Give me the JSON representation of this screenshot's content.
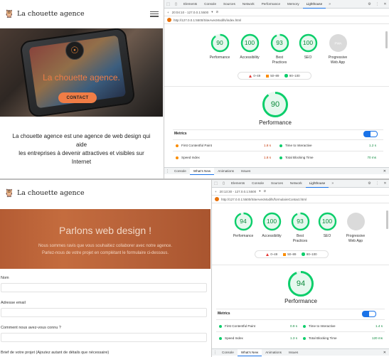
{
  "top_site": {
    "brand": "La chouette agence",
    "hero_title": "La chouette agence.",
    "contact_label": "CONTACT",
    "intro_line1": "La chouette agence est une agence de web design qui",
    "intro_line2": "aide",
    "intro_line3": "les entreprises à devenir attractives et visibles sur",
    "intro_line4": "Internet"
  },
  "bottom_site": {
    "brand": "La chouette agence",
    "banner_title": "Parlons web design !",
    "banner_p1": "Nous sommes ravis que vous souhaitiez collaborer avec notre agence.",
    "banner_p2": "Parlez-nous de votre projet en complétant le formulaire ci-dessous.",
    "fields": [
      {
        "label": "Nom"
      },
      {
        "label": "Adresse email"
      },
      {
        "label": "Comment nous avez-vous connu ?"
      },
      {
        "label": "Brief de votre projet (Ajoutez autant de détails que nécessaire)"
      }
    ]
  },
  "devtools_top": {
    "tabs": [
      "Elements",
      "Console",
      "Sources",
      "Network",
      "Performance",
      "Memory",
      "Lighthouse"
    ],
    "active_tab": "Lighthouse",
    "report_label": "20:04:10 - 127.0.0.1:5500",
    "url": "http://127.0.0.1:5500/SiteAvecModifs/index.html",
    "gauges": [
      {
        "score": "90",
        "label1": "Performance",
        "label2": "",
        "color": "#0cce6b"
      },
      {
        "score": "100",
        "label1": "Accessibility",
        "label2": "",
        "color": "#0cce6b"
      },
      {
        "score": "93",
        "label1": "Best",
        "label2": "Practices",
        "color": "#0cce6b"
      },
      {
        "score": "100",
        "label1": "SEO",
        "label2": "",
        "color": "#0cce6b"
      },
      {
        "score": "PWA",
        "label1": "Progressive",
        "label2": "Web App",
        "color": "#cccccc"
      }
    ],
    "legend": [
      "0–49",
      "50–89",
      "90–100"
    ],
    "perf_score": "90",
    "perf_title": "Performance",
    "metrics_heading": "Metrics",
    "metrics": [
      {
        "name": "First Contentful Paint",
        "value": "1.8 s",
        "status": "orange"
      },
      {
        "name": "Time to Interactive",
        "value": "1.2 s",
        "status": "green"
      },
      {
        "name": "Speed Index",
        "value": "1.8 s",
        "status": "orange"
      },
      {
        "name": "Total Blocking Time",
        "value": "70 ms",
        "status": "green"
      }
    ],
    "drawer_tabs": [
      "Console",
      "What's New",
      "Animations",
      "Issues"
    ],
    "active_drawer": "What's New"
  },
  "devtools_bottom": {
    "tabs": [
      "Elements",
      "Console",
      "Sources",
      "Network",
      "Lighthouse"
    ],
    "active_tab": "Lighthouse",
    "report_label": "20:13:30 - 127.0.0.1:5500",
    "url": "http://127.0.0.1:5500/SiteAvecModifs/formulaireContact.html",
    "gauges": [
      {
        "score": "94",
        "label1": "Performance",
        "label2": "",
        "color": "#0cce6b"
      },
      {
        "score": "100",
        "label1": "Accessibility",
        "label2": "",
        "color": "#0cce6b"
      },
      {
        "score": "93",
        "label1": "Best",
        "label2": "Practices",
        "color": "#0cce6b"
      },
      {
        "score": "100",
        "label1": "SEO",
        "label2": "",
        "color": "#0cce6b"
      },
      {
        "score": "",
        "label1": "Progressive",
        "label2": "Web App",
        "color": "#cccccc"
      }
    ],
    "legend": [
      "0–49",
      "50–89",
      "90–100"
    ],
    "perf_score": "94",
    "perf_title": "Performance",
    "metrics_heading": "Metrics",
    "metrics": [
      {
        "name": "First Contentful Paint",
        "value": "0.9 s",
        "status": "green"
      },
      {
        "name": "Time to Interactive",
        "value": "1.4 s",
        "status": "green"
      },
      {
        "name": "Speed Index",
        "value": "1.3 s",
        "status": "green"
      },
      {
        "name": "Total Blocking Time",
        "value": "120 ms",
        "status": "green"
      }
    ],
    "drawer_tabs": [
      "Console",
      "What's New",
      "Animations",
      "Issues"
    ],
    "active_drawer": "What's New"
  }
}
